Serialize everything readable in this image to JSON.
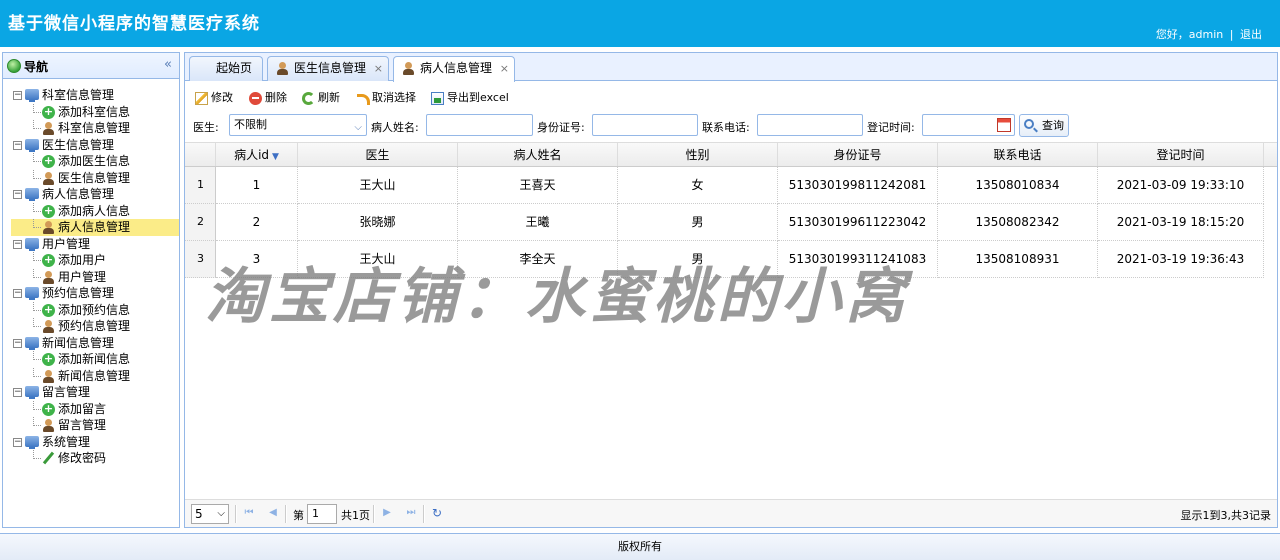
{
  "header": {
    "title": "基于微信小程序的智慧医疗系统",
    "greeting": "您好，admin",
    "separator": "|",
    "logout": "退出"
  },
  "nav": {
    "title": "导航",
    "collapse": "«",
    "groups": [
      {
        "label": "科室信息管理",
        "items": [
          {
            "label": "添加科室信息",
            "icon": "add-icon"
          },
          {
            "label": "科室信息管理",
            "icon": "user-icon"
          }
        ]
      },
      {
        "label": "医生信息管理",
        "items": [
          {
            "label": "添加医生信息",
            "icon": "add-icon"
          },
          {
            "label": "医生信息管理",
            "icon": "user-icon"
          }
        ]
      },
      {
        "label": "病人信息管理",
        "items": [
          {
            "label": "添加病人信息",
            "icon": "add-icon"
          },
          {
            "label": "病人信息管理",
            "icon": "user-icon"
          }
        ]
      },
      {
        "label": "用户管理",
        "items": [
          {
            "label": "添加用户",
            "icon": "add-icon"
          },
          {
            "label": "用户管理",
            "icon": "user-icon"
          }
        ]
      },
      {
        "label": "预约信息管理",
        "items": [
          {
            "label": "添加预约信息",
            "icon": "add-icon"
          },
          {
            "label": "预约信息管理",
            "icon": "user-icon"
          }
        ]
      },
      {
        "label": "新闻信息管理",
        "items": [
          {
            "label": "添加新闻信息",
            "icon": "add-icon"
          },
          {
            "label": "新闻信息管理",
            "icon": "user-icon"
          }
        ]
      },
      {
        "label": "留言管理",
        "items": [
          {
            "label": "添加留言",
            "icon": "add-icon"
          },
          {
            "label": "留言管理",
            "icon": "user-icon"
          }
        ]
      },
      {
        "label": "系统管理",
        "items": [
          {
            "label": "修改密码",
            "icon": "pencil-icon"
          }
        ]
      }
    ],
    "selected": "病人信息管理"
  },
  "tabs": [
    {
      "label": "起始页",
      "closable": false
    },
    {
      "label": "医生信息管理",
      "closable": true
    },
    {
      "label": "病人信息管理",
      "closable": true,
      "active": true
    }
  ],
  "tab_close": "×",
  "toolbar": {
    "edit": "修改",
    "delete": "删除",
    "refresh": "刷新",
    "cancel_select": "取消选择",
    "export": "导出到excel"
  },
  "filters": {
    "doctor_label": "医生:",
    "doctor_value": "不限制",
    "name_label": "病人姓名:",
    "idcard_label": "身份证号:",
    "phone_label": "联系电话:",
    "regtime_label": "登记时间:",
    "query": "查询"
  },
  "grid": {
    "columns": [
      "病人id",
      "医生",
      "病人姓名",
      "性别",
      "身份证号",
      "联系电话",
      "登记时间"
    ],
    "sort_arrow": "▼",
    "rows": [
      {
        "num": "1",
        "cells": [
          "1",
          "王大山",
          "王喜天",
          "女",
          "513030199811242081",
          "13508010834",
          "2021-03-09 19:33:10"
        ]
      },
      {
        "num": "2",
        "cells": [
          "2",
          "张晓娜",
          "王曦",
          "男",
          "513030199611223042",
          "13508082342",
          "2021-03-19 18:15:20"
        ]
      },
      {
        "num": "3",
        "cells": [
          "3",
          "王大山",
          "李全天",
          "男",
          "513030199311241083",
          "13508108931",
          "2021-03-19 19:36:43"
        ]
      }
    ]
  },
  "pager": {
    "page_size": "5",
    "page_prefix": "第",
    "page_value": "1",
    "page_suffix": "共1页",
    "info": "显示1到3,共3记录"
  },
  "footer": "版权所有",
  "watermark": "淘宝店铺：水蜜桃的小窝",
  "colors": {
    "header_bg": "#0aa6e4",
    "border": "#95b8e7",
    "selected": "#fbec88"
  }
}
